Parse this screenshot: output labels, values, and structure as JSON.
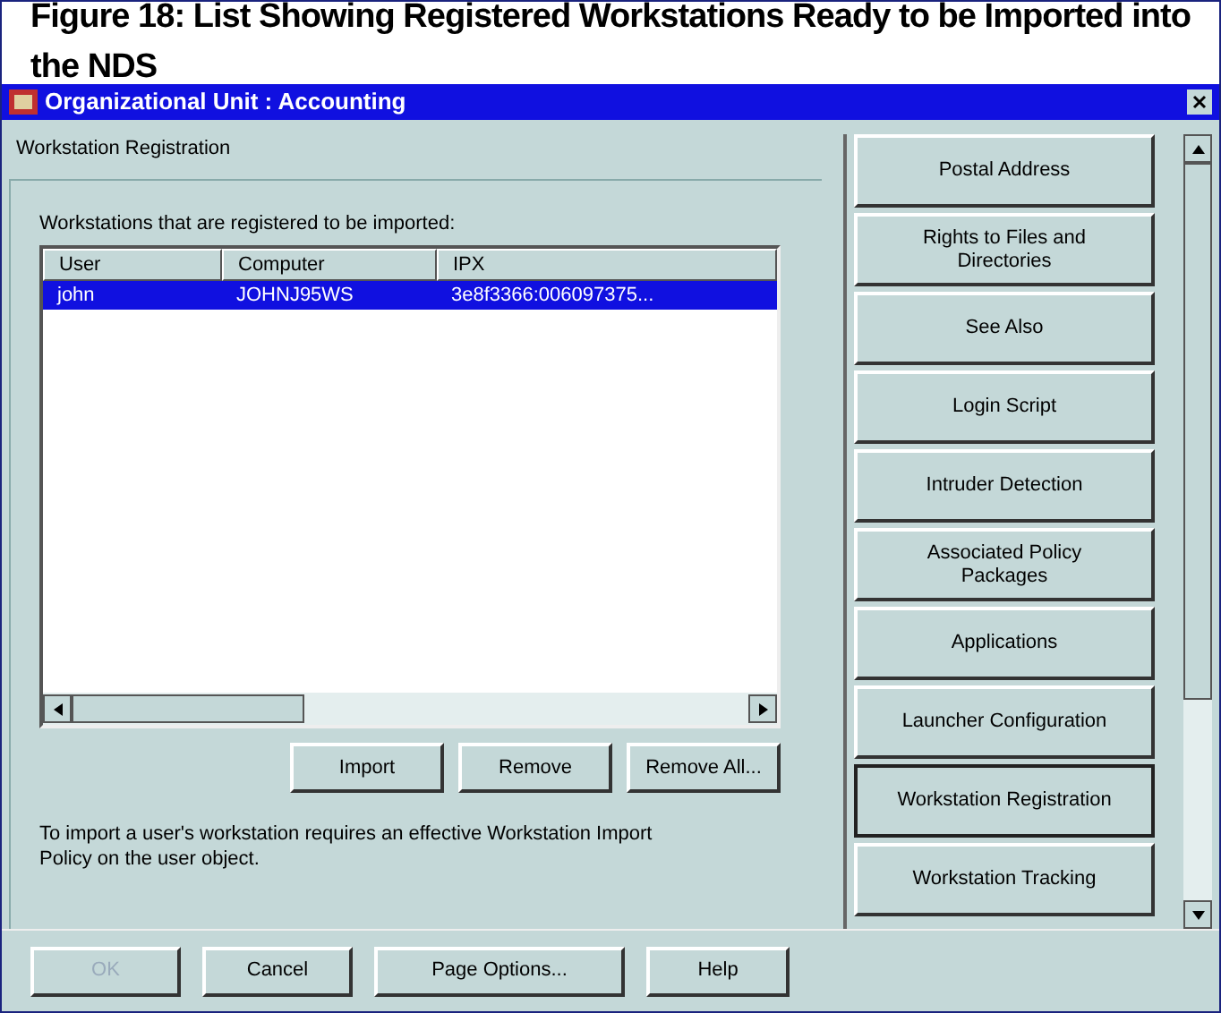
{
  "caption": "Figure 18: List Showing Registered Workstations Ready to be Imported into the NDS",
  "window": {
    "title": "Organizational Unit : Accounting"
  },
  "group": {
    "title": "Workstation Registration"
  },
  "list": {
    "label": "Workstations that are registered to be imported:",
    "columns": [
      "User",
      "Computer",
      "IPX"
    ],
    "rows": [
      {
        "cells": [
          "john",
          "JOHNJ95WS",
          "3e8f3366:006097375..."
        ],
        "selected": true
      }
    ]
  },
  "list_buttons": [
    {
      "label": "Import"
    },
    {
      "label": "Remove"
    },
    {
      "label": "Remove All..."
    }
  ],
  "note": "To import a user's workstation requires an effective Workstation Import Policy on the user object.",
  "page_tabs": [
    {
      "label": "Postal Address",
      "selected": false
    },
    {
      "label": "Rights to Files and Directories",
      "selected": false
    },
    {
      "label": "See Also",
      "selected": false
    },
    {
      "label": "Login Script",
      "selected": false
    },
    {
      "label": "Intruder Detection",
      "selected": false
    },
    {
      "label": "Associated Policy Packages",
      "selected": false
    },
    {
      "label": "Applications",
      "selected": false
    },
    {
      "label": "Launcher Configuration",
      "selected": false
    },
    {
      "label": "Workstation Registration",
      "selected": true
    },
    {
      "label": "Workstation Tracking",
      "selected": false
    }
  ],
  "buttons": [
    {
      "label": "OK",
      "disabled": true
    },
    {
      "label": "Cancel",
      "disabled": false
    },
    {
      "label": "Page Options...",
      "disabled": false
    },
    {
      "label": "Help",
      "disabled": false
    }
  ]
}
